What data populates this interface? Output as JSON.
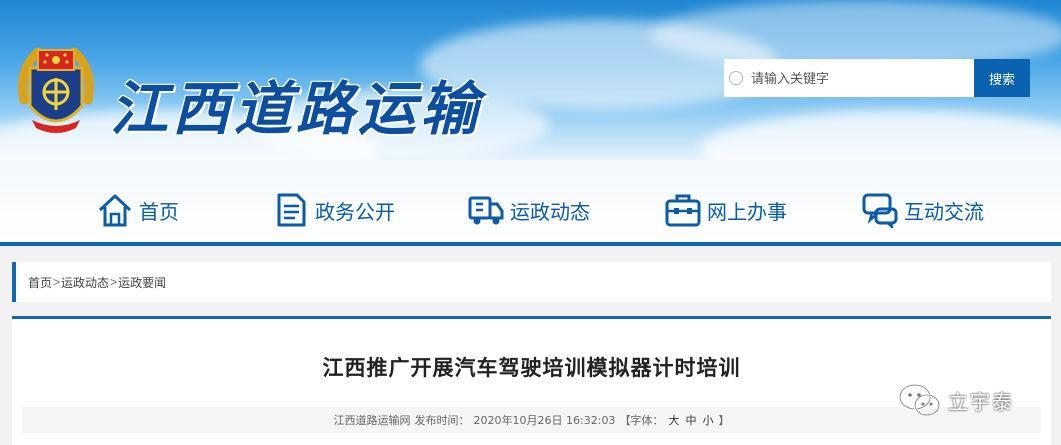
{
  "header": {
    "site_title": "江西道路运输",
    "search": {
      "placeholder": "请输入关键字",
      "button_label": "搜索"
    }
  },
  "nav": {
    "items": [
      {
        "label": "首页",
        "icon": "home-icon"
      },
      {
        "label": "政务公开",
        "icon": "document-icon"
      },
      {
        "label": "运政动态",
        "icon": "truck-icon"
      },
      {
        "label": "网上办事",
        "icon": "briefcase-icon"
      },
      {
        "label": "互动交流",
        "icon": "chat-icon"
      }
    ]
  },
  "breadcrumb": {
    "items": [
      "首页",
      "运政动态",
      "运政要闻"
    ],
    "separator": ">"
  },
  "article": {
    "title": "江西推广开展汽车驾驶培训模拟器计时培训",
    "meta": {
      "source": "江西道路运输网",
      "published_label": "发布时间：",
      "published_at": "2020年10月26日 16:32:03",
      "font_label_open": "【字体：",
      "font_large": "大",
      "font_medium": "中",
      "font_small": "小",
      "font_label_close": "】"
    }
  },
  "watermark": {
    "text": "立宇泰",
    "icon": "wechat-icon"
  },
  "colors": {
    "primary_blue": "#1267b5",
    "nav_text": "#0d5ba8",
    "search_button": "#0b63b0"
  }
}
